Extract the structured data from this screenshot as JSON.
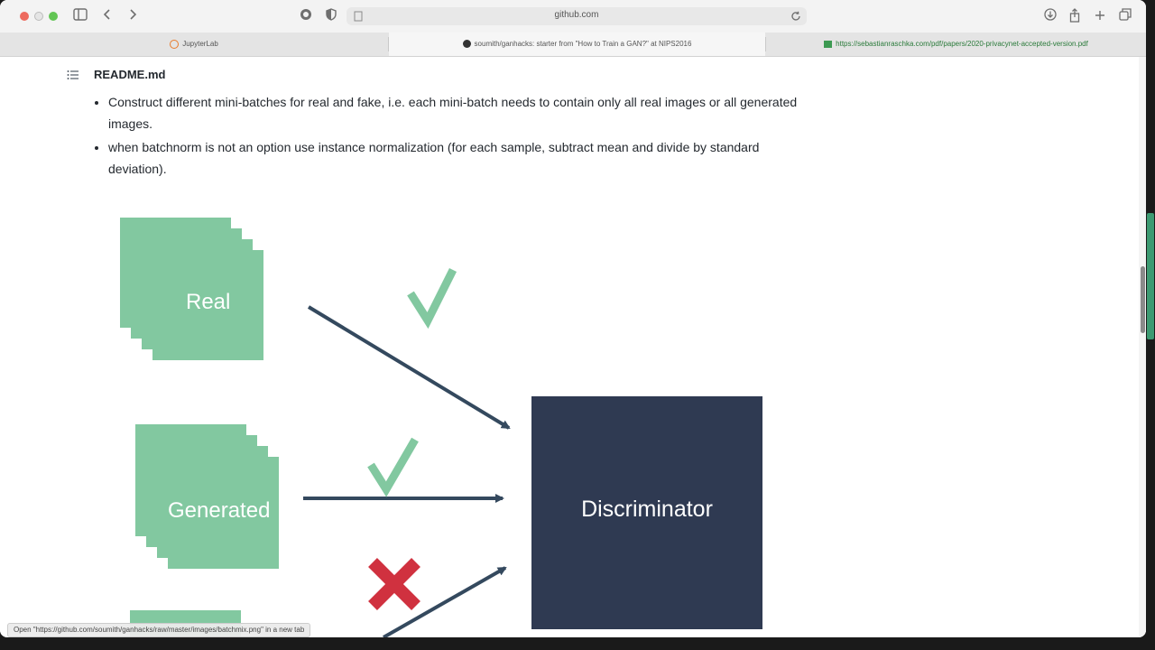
{
  "toolbar": {
    "address": "github.com"
  },
  "tabs": [
    {
      "label": "JupyterLab",
      "active": false
    },
    {
      "label": "soumith/ganhacks: starter from \"How to Train a GAN?\" at NIPS2016",
      "active": true
    },
    {
      "label": "https://sebastianraschka.com/pdf/papers/2020-privacynet-accepted-version.pdf",
      "active": false
    }
  ],
  "readme": {
    "title": "README.md",
    "bullets": [
      "Construct different mini-batches for real and fake, i.e. each mini-batch needs to contain only all real images or all generated images.",
      "when batchnorm is not an option use instance normalization (for each sample, subtract mean and divide by standard deviation)."
    ]
  },
  "diagram": {
    "real_label": "Real",
    "generated_label": "Generated",
    "discriminator_label": "Discriminator",
    "colors": {
      "stack": "#82c8a0",
      "discriminator": "#2f3a52",
      "check": "#82c8a0",
      "cross": "#d0313f",
      "arrow": "#34495e"
    }
  },
  "status": "Open \"https://github.com/soumith/ganhacks/raw/master/images/batchmix.png\" in a new tab"
}
